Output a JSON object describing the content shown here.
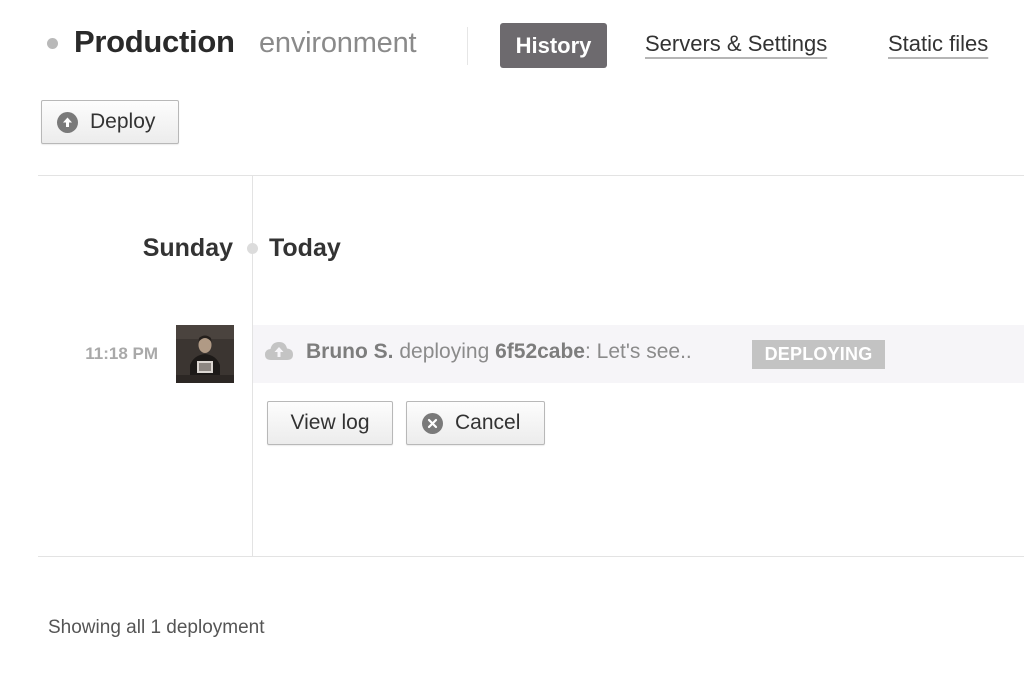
{
  "header": {
    "env_name": "Production",
    "env_suffix": "environment",
    "tabs": [
      {
        "label": "History",
        "active": true
      },
      {
        "label": "Servers & Settings",
        "active": false
      },
      {
        "label": "Static files",
        "active": false
      }
    ]
  },
  "toolbar": {
    "deploy_label": "Deploy",
    "deploy_icon": "arrow-up-circle-icon"
  },
  "timeline": {
    "day": "Sunday",
    "date": "Today",
    "entries": [
      {
        "time": "11:18 PM",
        "user": "Bruno S.",
        "action": "deploying",
        "commit": "6f52cabe",
        "message": ": Let's see..",
        "status": "DEPLOYING",
        "actions": {
          "view_log_label": "View log",
          "cancel_label": "Cancel"
        }
      }
    ]
  },
  "footer": {
    "summary": "Showing all 1 deployment"
  },
  "colors": {
    "active_tab_bg": "#6d6a6e",
    "badge_bg": "#c3c3c3",
    "row_bg": "#f6f5f8"
  }
}
